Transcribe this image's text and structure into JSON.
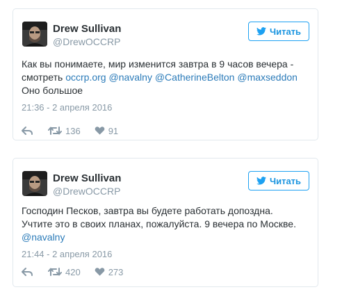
{
  "colors": {
    "link": "#2b7bb9",
    "muted": "#8899a6",
    "follow_accent": "#1da1f2",
    "border": "#e1e8ed"
  },
  "tweets": [
    {
      "author_name": "Drew Sullivan",
      "author_handle": "@DrewOCCRP",
      "follow_label": "Читать",
      "follow_icon": "twitter-bird-icon",
      "text_lines": [
        {
          "plain": "Как вы понимаете, мир изменится завтра в 9 часов вечера -"
        },
        {
          "plain": "смотреть",
          "links": [
            "occrp.org",
            "@navalny",
            "@CatherineBelton",
            "@maxseddon"
          ]
        },
        {
          "plain": "Оно большое"
        }
      ],
      "timestamp": "21:36 - 2 апреля 2016",
      "retweets": "136",
      "likes": "91",
      "icons": {
        "reply": "reply-icon",
        "retweet": "retweet-icon",
        "like": "heart-icon"
      }
    },
    {
      "author_name": "Drew Sullivan",
      "author_handle": "@DrewOCCRP",
      "follow_label": "Читать",
      "follow_icon": "twitter-bird-icon",
      "text_lines": [
        {
          "plain": "Господин Песков, завтра вы будете работать допоздна."
        },
        {
          "plain": "Учтите это в своих планах, пожалуйста. 9 вечера по Москве."
        },
        {
          "plain": "",
          "links": [
            "@navalny"
          ]
        }
      ],
      "timestamp": "21:44 - 2 апреля 2016",
      "retweets": "420",
      "likes": "273",
      "icons": {
        "reply": "reply-icon",
        "retweet": "retweet-icon",
        "like": "heart-icon"
      }
    }
  ]
}
